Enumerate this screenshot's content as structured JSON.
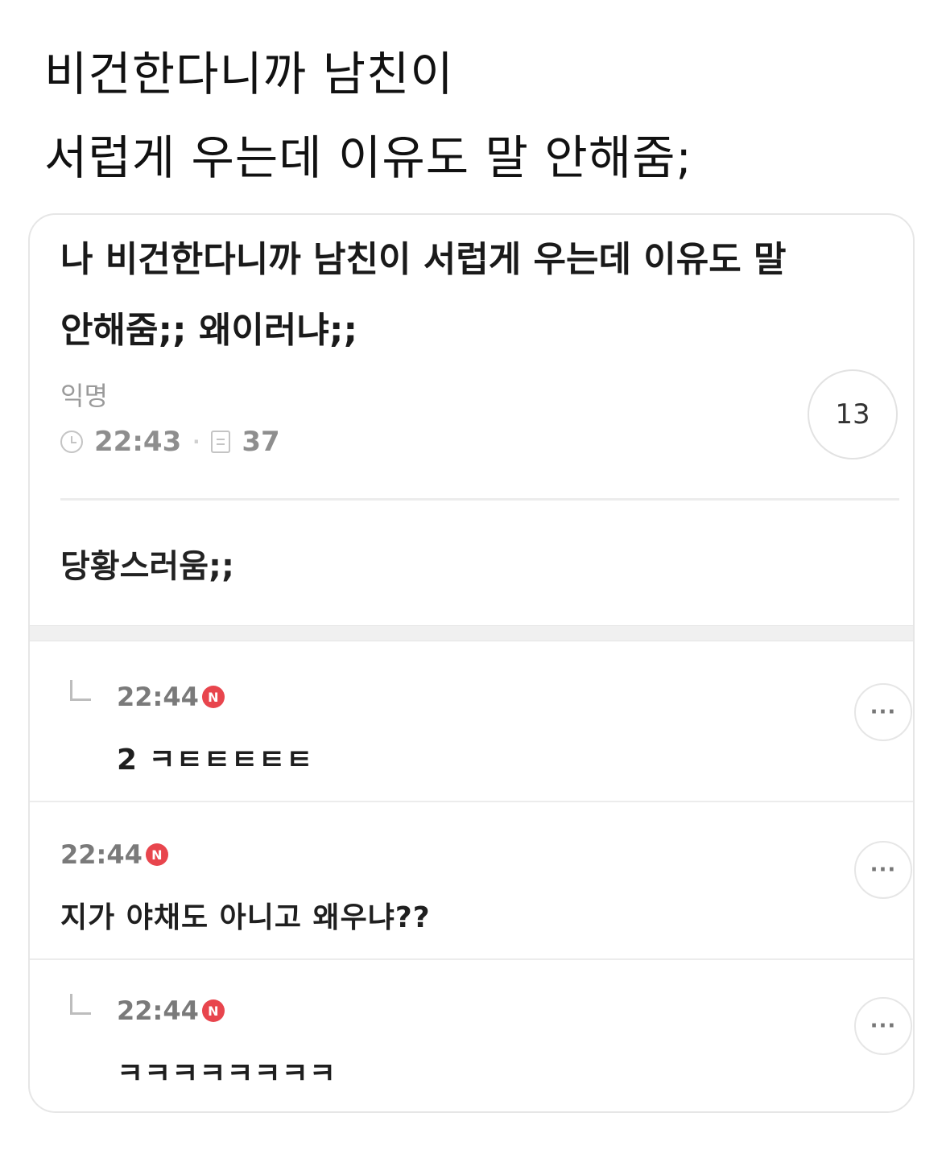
{
  "tweet": {
    "line1": "비건한다니까 남친이",
    "line2": "서럽게 우는데 이유도 말 안해줌;"
  },
  "post": {
    "title_line1": "나 비건한다니까 남친이 서럽게 우는데 이유도 말",
    "title_line2": "안해줌;; 왜이러냐;;",
    "author": "익명",
    "time": "22:43",
    "separator": "·",
    "views": "37",
    "comment_count": "13",
    "body": "당황스러움;;"
  },
  "comments": [
    {
      "time": "22:44",
      "badge": "N",
      "text": "2 ㅋㅌㅌㅌㅌㅌ",
      "more": "···",
      "is_reply": true
    },
    {
      "time": "22:44",
      "badge": "N",
      "text": "지가 야채도 아니고 왜우냐??",
      "more": "···",
      "is_reply": false
    },
    {
      "time": "22:44",
      "badge": "N",
      "text": "ㅋㅋㅋㅋㅋㅋㅋㅋ",
      "more": "···",
      "is_reply": true
    }
  ]
}
